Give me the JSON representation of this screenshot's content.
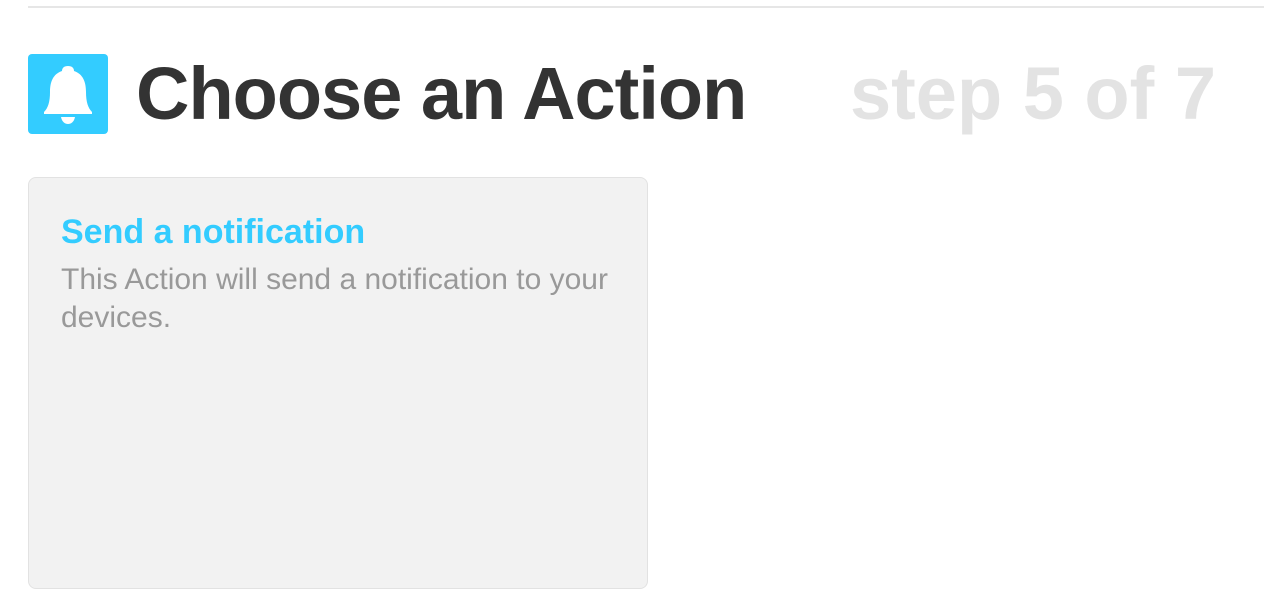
{
  "header": {
    "title": "Choose an Action",
    "step": "step 5 of 7",
    "service_icon": "bell-icon"
  },
  "colors": {
    "accent": "#33ccff",
    "title": "#333333",
    "step": "#e3e3e3",
    "card_bg": "#f2f2f2",
    "description": "#999999"
  },
  "actions": [
    {
      "title": "Send a notification",
      "description": "This Action will send a notification to your devices."
    }
  ]
}
